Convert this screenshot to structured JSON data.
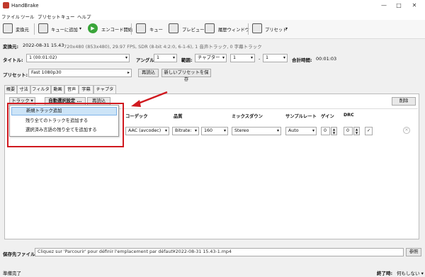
{
  "window": {
    "title": "HandBrake",
    "minimize": "—",
    "maximize": "□",
    "close": "✕"
  },
  "menu": [
    "ファイル",
    "ツール",
    "プリセット",
    "キュー",
    "ヘルプ"
  ],
  "toolbar": {
    "source": "変換元",
    "add_queue": "キューに追加",
    "start": "エンコード開始",
    "queue": "キュー",
    "preview": "プレビュー",
    "history": "履歴ウィンドウ",
    "presets": "プリセット"
  },
  "source": {
    "label": "変換元:",
    "value": "2022-08-31 15.43",
    "info": "720x480 (853x480), 29.97 FPS, SDR (8-bit 4:2:0, 6-1-6), 1 音声トラック, 0 字幕トラック"
  },
  "title_row": {
    "title_label": "タイトル:",
    "title_value": "1 (00:01:02)",
    "angle_label": "アングル:",
    "angle_value": "1",
    "range_label": "範囲:",
    "range_type": "チャプター",
    "range_from": "1",
    "range_dash": "-",
    "range_to": "1",
    "duration_label": "合計時間:",
    "duration_value": "00:01:03"
  },
  "preset_row": {
    "label": "プリセット:",
    "value": "Fast 1080p30",
    "reload": "再読込",
    "save_new": "新しいプリセットを保存"
  },
  "tabs": [
    "概要",
    "寸法",
    "フィルタ",
    "動画",
    "音声",
    "字幕",
    "チャプター"
  ],
  "audio": {
    "track_btn": "トラック",
    "auto_btn": "自動選択設定 ...",
    "reload_btn": "再読込",
    "delete_btn": "削除",
    "columns": {
      "codec": "コーデック",
      "quality": "品質",
      "mixdown": "ミックスダウン",
      "samplerate": "サンプルレート",
      "gain": "ゲイン",
      "drc": "DRC"
    },
    "row": {
      "codec": "AAC (avcodec)",
      "quality_mode": "Bitrate:",
      "bitrate": "160",
      "mixdown": "Stereo",
      "samplerate": "Auto",
      "gain": "0",
      "drc": "0",
      "check": "✓"
    },
    "menu_items": [
      "新規トラック追加",
      "残り全てのトラックを追加する",
      "選択済み言語の残り全てを追加する"
    ]
  },
  "destination": {
    "label": "保存先ファイル:",
    "value": "Cliquez sur 'Parcourir' pour définir l'emplacement par défaut¥2022-08-31 15.43-1.mp4",
    "browse": "参照"
  },
  "status": {
    "left": "準備完了",
    "right_label": "終了時:",
    "right_value": "何もしない"
  },
  "colors": {
    "highlight": "#cce4f7",
    "annotation": "#d0191f"
  }
}
